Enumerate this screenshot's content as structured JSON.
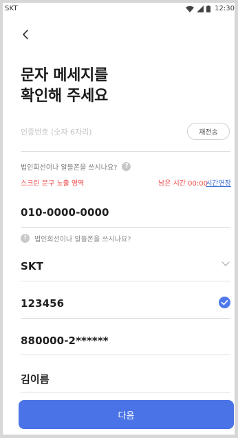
{
  "status_bar": {
    "carrier": "SKT",
    "time": "12:30"
  },
  "page": {
    "title_line1": "문자 메세지를",
    "title_line2": "확인해 주세요"
  },
  "verification": {
    "placeholder": "인증번호 (숫자 6자리)",
    "resend_label": "재전송"
  },
  "question_text": "법인회선이나 알뜰폰을 쓰시나요?",
  "notice": {
    "left_text": "스크린 문구 노출 영역",
    "remaining_time": "남은 시간 00:00",
    "extend_label": "시간연장"
  },
  "phone_number": "010-0000-0000",
  "info_text": "법인회선이나 알뜰폰을 쓰시나요?",
  "telecom": "SKT",
  "code_value": "123456",
  "resident_number": "880000-2******",
  "name": "김이름",
  "next_label": "다음",
  "colors": {
    "accent": "#4a73e7",
    "notice_red": "#ef4b4b",
    "link_blue": "#3f6ed8",
    "check_blue": "#4f79ea"
  },
  "icons": {
    "back": "chevron-left-icon",
    "question": "question-circle-icon",
    "info": "info-circle-icon",
    "dropdown": "chevron-down-icon",
    "verified": "check-circle-icon",
    "wifi": "wifi-icon",
    "signal": "signal-icon",
    "battery": "battery-icon"
  }
}
